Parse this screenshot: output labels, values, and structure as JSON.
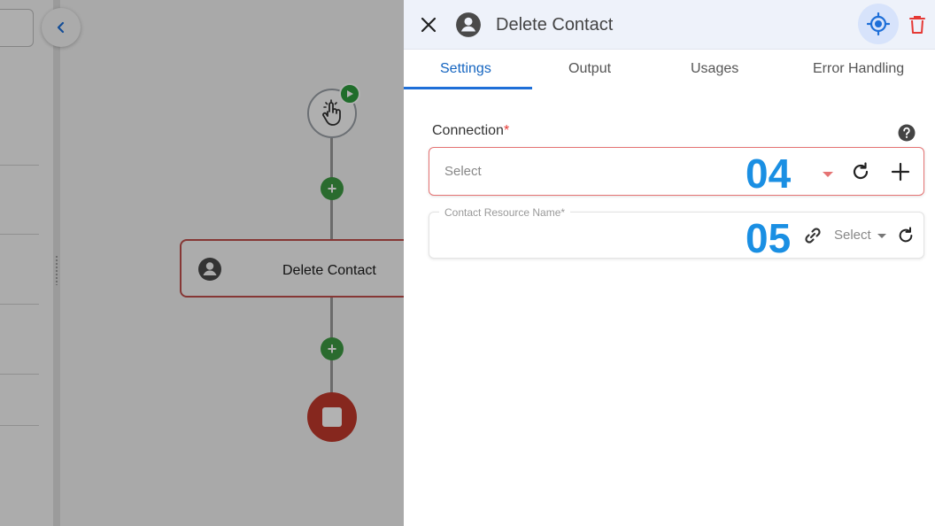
{
  "canvas": {
    "action_node_label": "Delete Contact"
  },
  "panel": {
    "title": "Delete Contact",
    "tabs": [
      {
        "label": "Settings",
        "active": true
      },
      {
        "label": "Output",
        "active": false
      },
      {
        "label": "Usages",
        "active": false
      },
      {
        "label": "Error Handling",
        "active": false
      }
    ],
    "connection": {
      "label": "Connection",
      "required_mark": "*",
      "placeholder": "Select"
    },
    "contact_resource": {
      "label": "Contact Resource Name*",
      "select_label": "Select"
    }
  },
  "callouts": {
    "first": "04",
    "second": "05"
  },
  "colors": {
    "accent": "#1e6fd8",
    "error": "#e53935",
    "callout": "#1a8fe3",
    "add_node": "#3d9a42",
    "end_node": "#c0392b"
  },
  "icons": [
    "close-icon",
    "user-avatar-icon",
    "locate-icon",
    "trash-icon",
    "help-icon",
    "refresh-icon",
    "plus-icon",
    "link-icon",
    "chevron-left-icon",
    "pointer-hand-icon",
    "play-icon"
  ]
}
